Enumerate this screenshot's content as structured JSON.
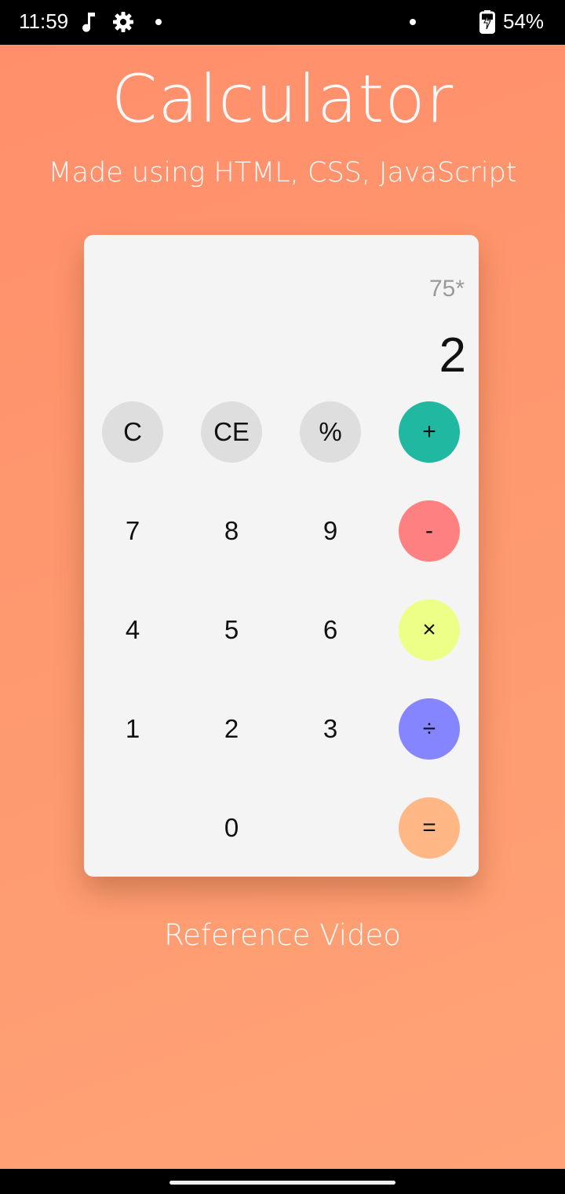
{
  "status_bar": {
    "time": "11:59",
    "battery": "54%",
    "icons": [
      "music-icon",
      "gear-icon",
      "dot-icon",
      "dot-icon",
      "battery-charging-icon"
    ]
  },
  "app": {
    "title": "Calculator",
    "subtitle": "Made using HTML, CSS, JavaScript",
    "reference_link": "Reference Video"
  },
  "calculator": {
    "previous_operand": "75*",
    "current_operand": "2",
    "keys": {
      "clear": "C",
      "clear_entry": "CE",
      "percent": "%",
      "add": "+",
      "seven": "7",
      "eight": "8",
      "nine": "9",
      "subtract": "-",
      "four": "4",
      "five": "5",
      "six": "6",
      "multiply": "×",
      "one": "1",
      "two": "2",
      "three": "3",
      "divide": "÷",
      "zero": "0",
      "equals": "="
    }
  },
  "colors": {
    "background": "#ff9470",
    "card": "#f4f4f4",
    "function_key": "#dedede",
    "add": "#21b8a1",
    "subtract": "#ff8080",
    "multiply": "#eeff88",
    "divide": "#8585ff",
    "equals": "#ffb885"
  }
}
